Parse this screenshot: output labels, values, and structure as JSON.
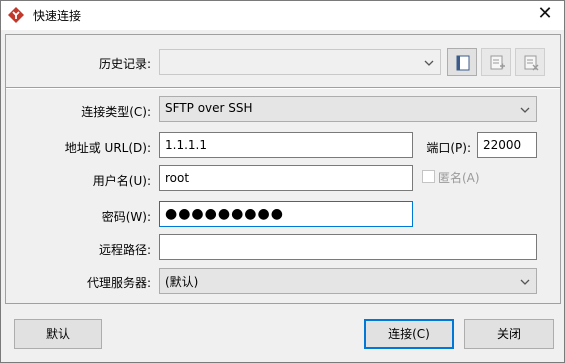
{
  "window": {
    "title": "快速连接",
    "close_glyph": "✕"
  },
  "history": {
    "label": "历史记录:",
    "value": ""
  },
  "form": {
    "conn_type_label": "连接类型(C):",
    "conn_type_value": "SFTP over SSH",
    "host_label": "地址或 URL(D):",
    "host_value": "1.1.1.1",
    "port_label": "端口(P):",
    "port_value": "22000",
    "user_label": "用户名(U):",
    "user_value": "root",
    "anonymous_label": "匿名(A)",
    "password_label": "密码(W):",
    "password_value": "●●●●●●●●●",
    "remote_path_label": "远程路径:",
    "remote_path_value": "",
    "proxy_label": "代理服务器:",
    "proxy_value": "(默认)"
  },
  "buttons": {
    "default_label": "默认",
    "connect_label": "连接(C)",
    "close_label": "关闭"
  },
  "colors": {
    "accent": "#0078d7",
    "app_icon": "#c0392b",
    "face": "#f0f0f0"
  }
}
